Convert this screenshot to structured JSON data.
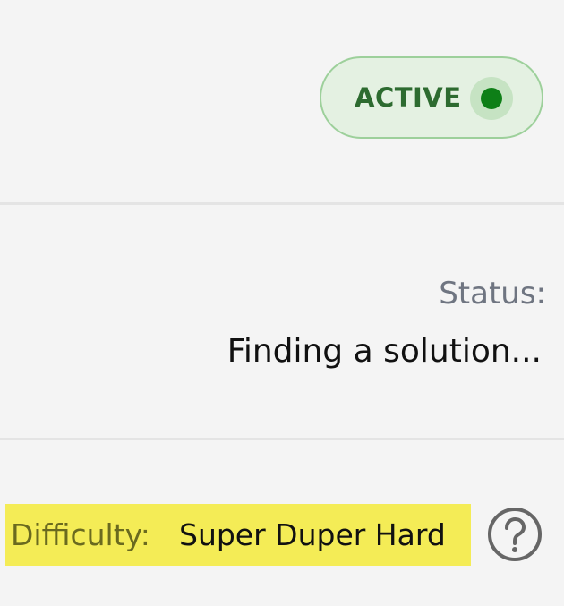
{
  "status_badge": {
    "label": "ACTIVE",
    "color": "#0e7f17"
  },
  "status": {
    "label": "Status:",
    "value": "Finding a solution..."
  },
  "difficulty": {
    "label": "Difficulty:",
    "value": "Super Duper Hard",
    "highlight_color": "#f4ec56",
    "help_icon": "question-circle-icon"
  }
}
